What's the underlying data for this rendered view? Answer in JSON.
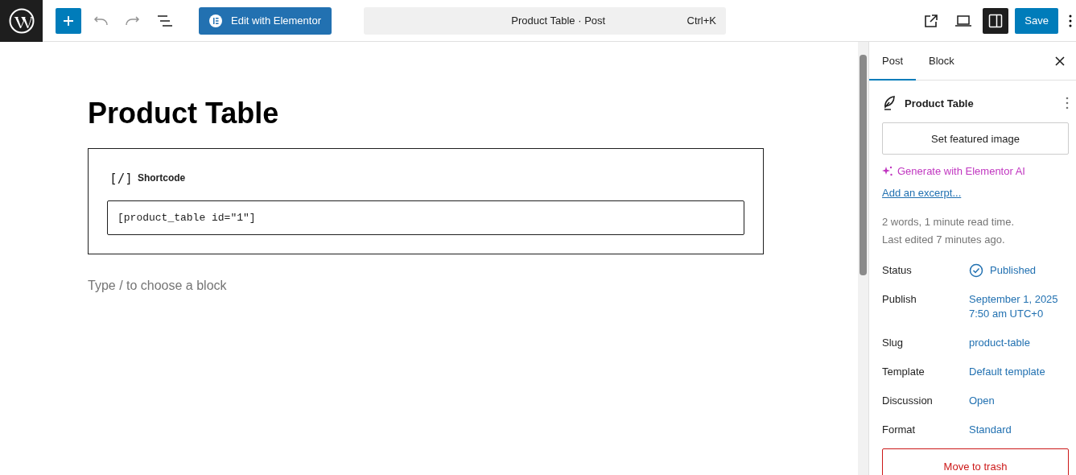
{
  "toolbar": {
    "elementor_button": "Edit with Elementor",
    "command_bar": {
      "title": "Product Table · Post",
      "shortcut": "Ctrl+K"
    },
    "settings_toggle": {
      "on": true
    },
    "save_button": "Save"
  },
  "editor": {
    "title": "Product Table",
    "block": {
      "icon_text": "[/]",
      "label": "Shortcode",
      "value": "[product_table id=\"1\"]"
    },
    "appender_placeholder": "Type / to choose a block"
  },
  "sidebar": {
    "tabs": [
      {
        "label": "Post",
        "selected": true
      },
      {
        "label": "Block",
        "selected": false
      }
    ],
    "post_title": "Product Table",
    "featured_image_button": "Set featured image",
    "ai_link": "Generate with Elementor AI",
    "excerpt_link": "Add an excerpt...",
    "stats": [
      "2 words, 1 minute read time.",
      "Last edited 7 minutes ago."
    ],
    "fields": [
      {
        "kind": "status",
        "label": "Status",
        "value": [
          "Published"
        ]
      },
      {
        "kind": "link",
        "label": "Publish",
        "value": [
          "September 1, 2025",
          "7:50 am UTC+0"
        ]
      },
      {
        "kind": "link",
        "label": "Slug",
        "value": [
          "product-table"
        ]
      },
      {
        "kind": "link",
        "label": "Template",
        "value": [
          "Default template"
        ]
      },
      {
        "kind": "link",
        "label": "Discussion",
        "value": [
          "Open"
        ]
      },
      {
        "kind": "link",
        "label": "Format",
        "value": [
          "Standard"
        ]
      }
    ],
    "trash_button": "Move to trash"
  }
}
